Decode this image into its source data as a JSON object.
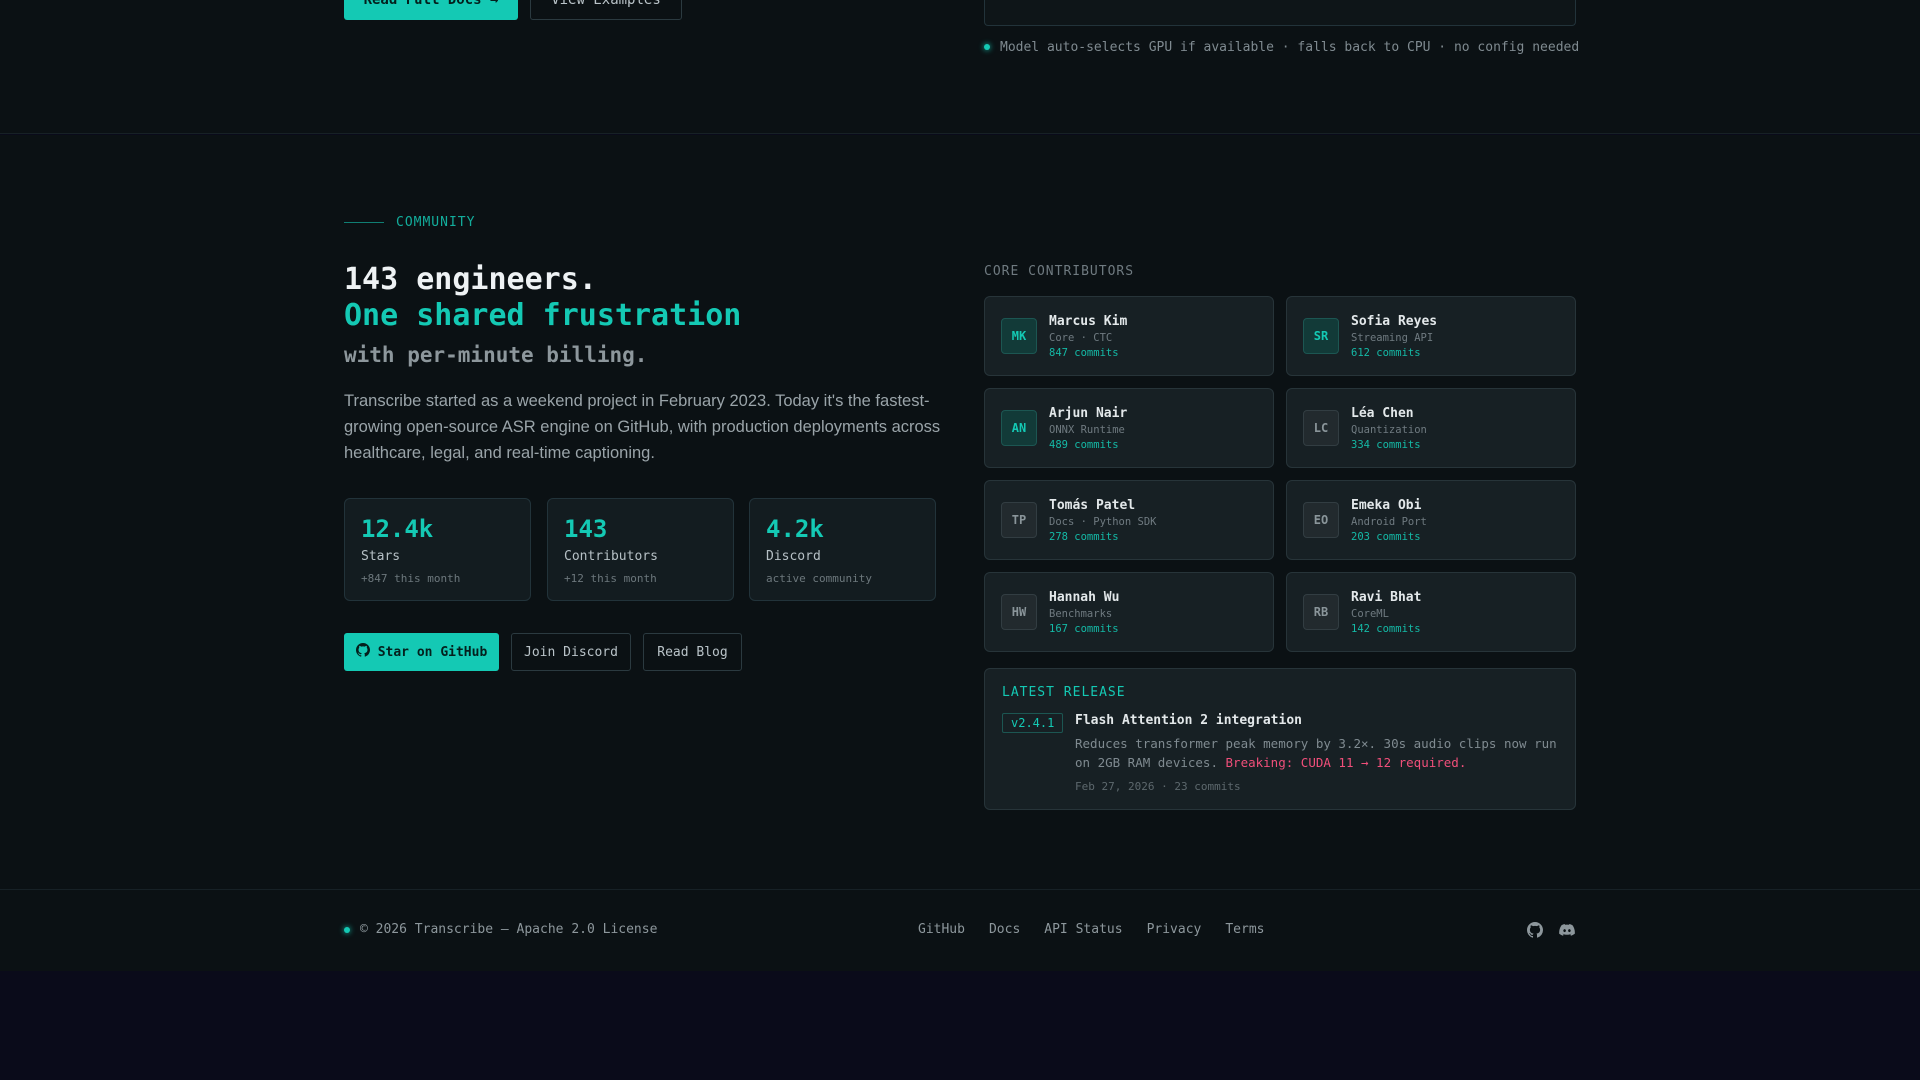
{
  "top": {
    "primary_button_label": "Read Full Docs →",
    "secondary_button_label": "View Examples",
    "note": "Model auto-selects GPU if available · falls back to CPU · no config needed"
  },
  "community": {
    "eyebrow": "COMMUNITY",
    "headline_line1": "143 engineers.",
    "headline_line2": "One shared frustration",
    "headline_line3": "with per-minute billing.",
    "paragraph": "Transcribe started as a weekend project in February 2023. Today it's the fastest-growing open-source ASR engine on GitHub, with production deployments across healthcare, legal, and real-time captioning.",
    "stats": [
      {
        "value": "12.4k",
        "label": "Stars",
        "sub": "+847 this month"
      },
      {
        "value": "143",
        "label": "Contributors",
        "sub": "+12 this month"
      },
      {
        "value": "4.2k",
        "label": "Discord",
        "sub": "active community"
      }
    ],
    "buttons": {
      "github": "Star on GitHub",
      "discord": "Join Discord",
      "blog": "Read Blog"
    }
  },
  "contributors": {
    "label": "CORE CONTRIBUTORS",
    "items": [
      {
        "initials": "MK",
        "name": "Marcus Kim",
        "role": "Core · CTC",
        "commits": "847 commits",
        "style": "teal"
      },
      {
        "initials": "SR",
        "name": "Sofia Reyes",
        "role": "Streaming API",
        "commits": "612 commits",
        "style": "teal"
      },
      {
        "initials": "AN",
        "name": "Arjun Nair",
        "role": "ONNX Runtime",
        "commits": "489 commits",
        "style": "teal"
      },
      {
        "initials": "LC",
        "name": "Léa Chen",
        "role": "Quantization",
        "commits": "334 commits",
        "style": "gray"
      },
      {
        "initials": "TP",
        "name": "Tomás Patel",
        "role": "Docs · Python SDK",
        "commits": "278 commits",
        "style": "gray"
      },
      {
        "initials": "EO",
        "name": "Emeka Obi",
        "role": "Android Port",
        "commits": "203 commits",
        "style": "gray"
      },
      {
        "initials": "HW",
        "name": "Hannah Wu",
        "role": "Benchmarks",
        "commits": "167 commits",
        "style": "gray"
      },
      {
        "initials": "RB",
        "name": "Ravi Bhat",
        "role": "CoreML",
        "commits": "142 commits",
        "style": "gray"
      }
    ]
  },
  "release": {
    "label": "LATEST RELEASE",
    "version": "v2.4.1",
    "title": "Flash Attention 2 integration",
    "description": "Reduces transformer peak memory by 3.2×. 30s audio clips now run on 2GB RAM devices.",
    "breaking": "Breaking: CUDA 11 → 12 required.",
    "meta": "Feb 27, 2026 · 23 commits"
  },
  "footer": {
    "copyright": "© 2026 Transcribe — Apache 2.0 License",
    "nav": [
      "GitHub",
      "Docs",
      "API Status",
      "Privacy",
      "Terms"
    ]
  },
  "colors": {
    "accent": "#14c9b4",
    "background": "#0b1114",
    "card": "#172024",
    "breaking": "#f04f7a"
  },
  "icons": {
    "github": "github-icon",
    "discord": "discord-icon"
  }
}
